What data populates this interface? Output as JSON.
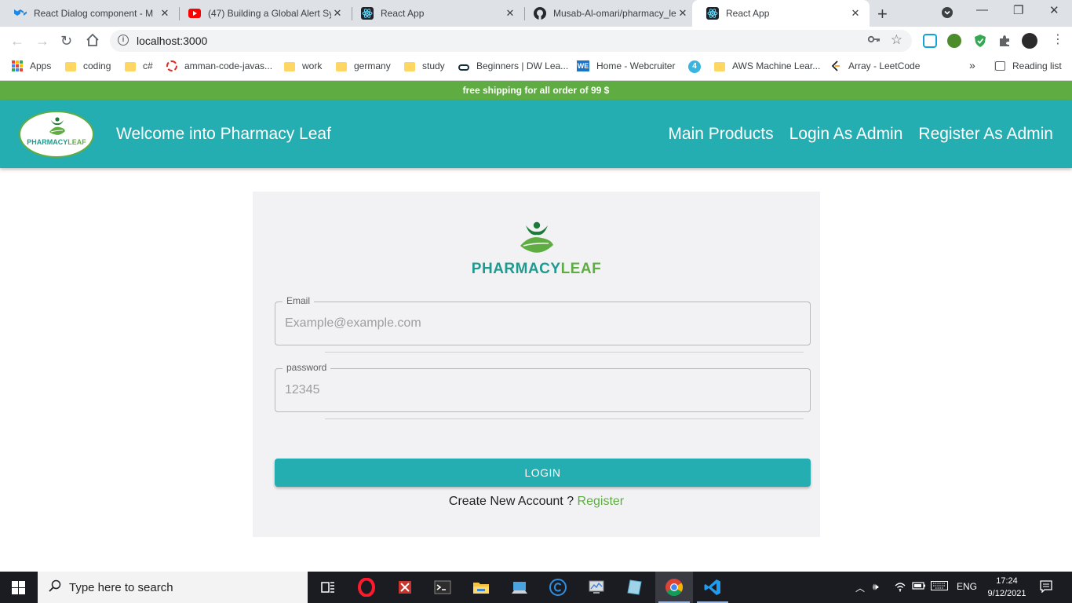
{
  "browser": {
    "tabs": [
      {
        "title": "React Dialog component - M",
        "icon": "mui-icon"
      },
      {
        "title": "(47) Building a Global Alert Sy",
        "icon": "youtube-icon"
      },
      {
        "title": "React App",
        "icon": "react-icon"
      },
      {
        "title": "Musab-Al-omari/pharmacy_le",
        "icon": "github-icon"
      },
      {
        "title": "React App",
        "icon": "react-icon",
        "active": true
      }
    ],
    "url": "localhost:3000",
    "bookmarks": [
      {
        "label": "Apps",
        "icon": "apps-grid-icon"
      },
      {
        "label": "coding",
        "icon": "folder-icon"
      },
      {
        "label": "c#",
        "icon": "folder-icon"
      },
      {
        "label": "amman-code-javas...",
        "icon": "ring-icon"
      },
      {
        "label": "work",
        "icon": "folder-icon"
      },
      {
        "label": "germany",
        "icon": "folder-icon"
      },
      {
        "label": "study",
        "icon": "folder-icon"
      },
      {
        "label": "Beginners | DW Lea...",
        "icon": "dw-icon"
      },
      {
        "label": "Home - Webcruiter",
        "icon": "we-icon"
      },
      {
        "label": "AWS Machine Lear...",
        "icon": "folder-icon"
      },
      {
        "label": "Array - LeetCode",
        "icon": "leetcode-icon"
      }
    ],
    "more_bookmarks": "»",
    "reading_list": "Reading list"
  },
  "site": {
    "promo_text": "free shipping for all order of 99 $",
    "logo": {
      "part1": "PHARMACY",
      "part2": "LEAF"
    },
    "welcome": "Welcome into Pharmacy Leaf",
    "nav": [
      "Main Products",
      "Login As Admin",
      "Register As Admin"
    ],
    "brand_colors": {
      "teal": "#24aeb1",
      "green": "#5fad42",
      "dark_teal": "#1f9a8e"
    }
  },
  "login": {
    "email_label": "Email",
    "email_placeholder": "Example@example.com",
    "password_label": "password",
    "password_placeholder": "12345",
    "button": "LOGIN",
    "prompt": "Create New Account ? ",
    "register_link": "Register"
  },
  "taskbar": {
    "search_placeholder": "Type here to search",
    "language": "ENG",
    "time": "17:24",
    "date": "9/12/2021"
  }
}
